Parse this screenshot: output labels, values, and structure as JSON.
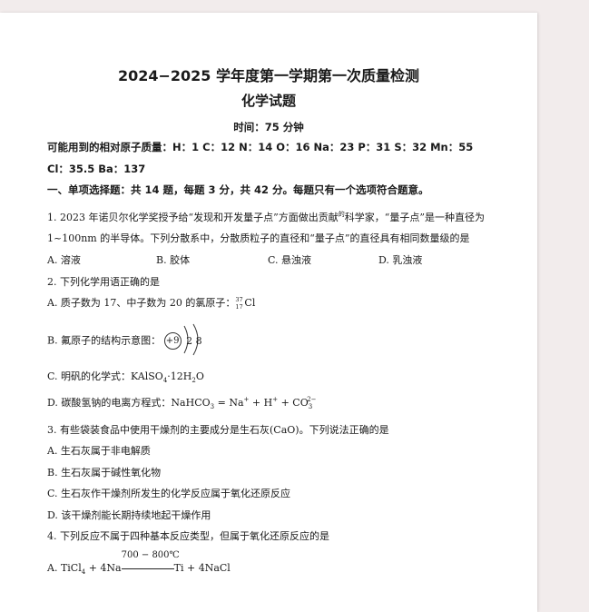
{
  "title": "2024−2025 学年度第一学期第一次质量检测",
  "subtitle": "化学试题",
  "time": "时间：75 分钟",
  "atomic_mass_line1": "可能用到的相对原子质量：H：1   C：12   N：14   O：16   Na：23   P：31   S：32   Mn：55",
  "atomic_mass_line2": "Cl：35.5   Ba：137",
  "section1": "一、单项选择题：共 14 题，每题 3 分，共 42 分。每题只有一个选项符合题意。",
  "q1": {
    "line1": "1. 2023 年诺贝尔化学奖授予给“发现和开发量子点”方面做出贡献",
    "sup": "的",
    "line1b": "科学家，“量子点”是一种直径为",
    "line2": "1~100nm 的半导体。下列分散系中，分散质粒子的直径和“量子点”的直径具有相同数量级的是",
    "options": [
      "A. 溶液",
      "B. 胶体",
      "C. 悬浊液",
      "D. 乳浊液"
    ]
  },
  "q2": {
    "stem": "2. 下列化学用语正确的是",
    "a": "A. 质子数为 17、中子数为 20 的氯原子：",
    "a_mass": "37",
    "a_num": "17",
    "a_sym": "Cl",
    "b": "B. 氟原子的结构示意图：",
    "b_nucleus": "+9",
    "b_shells": "2 8",
    "c": "C. 明矾的化学式：",
    "c_formula_pre": "KAlSO",
    "c_sub": "4",
    "c_formula_post": "·12H",
    "c_sub2": "2",
    "c_o": "O",
    "d": "D. 碳酸氢钠的电离方程式：",
    "d_eq_pre": "NaHCO",
    "d_sub": "3",
    "d_eq_mid": " = Na",
    "d_sup1": "+",
    "d_eq_mid2": " + H",
    "d_sup2": "+",
    "d_eq_mid3": " + CO",
    "d_sub3": "3",
    "d_sup3": "2−"
  },
  "q3": {
    "stem": "3. 有些袋装食品中使用干燥剂的主要成分是生石灰(CaO)。下列说法正确的是",
    "options": [
      "A. 生石灰属于非电解质",
      "B. 生石灰属于碱性氧化物",
      "C. 生石灰作干燥剂所发生的化学反应属于氧化还原反应",
      "D. 该干燥剂能长期持续地起干燥作用"
    ]
  },
  "q4": {
    "stem": "4. 下列反应不属于四种基本反应类型，但属于氧化还原反应的是",
    "a": "A.",
    "a_pre": "TiCl",
    "a_sub": "4",
    "a_mid": " + 4Na",
    "a_cond": "700 − 800℃",
    "a_post": "Ti + 4NaCl"
  }
}
